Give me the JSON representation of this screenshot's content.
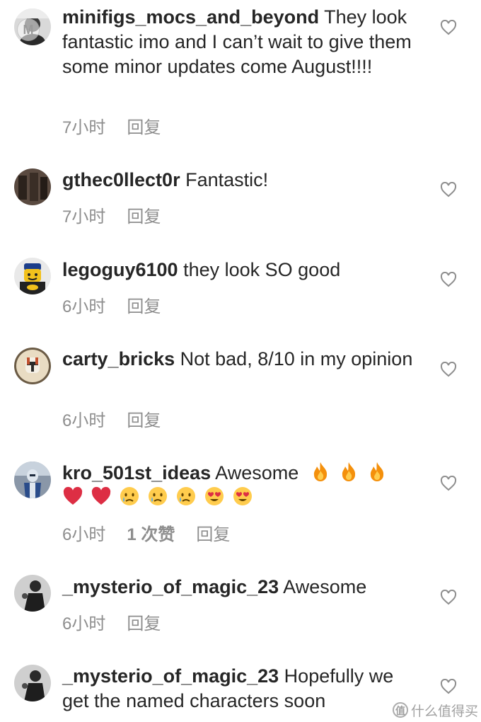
{
  "comments": [
    {
      "username": "minifigs_mocs_and_beyond",
      "text": " They look fantastic imo and I can’t wait to give them some minor updates come August!!!!",
      "time": "7小时",
      "reply": "回复",
      "avatar_icon": "avatar-person-icon"
    },
    {
      "username": "gthec0llect0r",
      "text": " Fantastic!",
      "time": "7小时",
      "reply": "回复",
      "avatar_icon": "avatar-figure-icon"
    },
    {
      "username": "legoguy6100",
      "text": " they look SO good",
      "time": "6小时",
      "reply": "回复",
      "avatar_icon": "avatar-lego-minifig-icon"
    },
    {
      "username": "carty_bricks",
      "text": " Not bad, 8/10 in my opinion",
      "time": "6小时",
      "reply": "回复",
      "avatar_icon": "avatar-clone-trooper-icon"
    },
    {
      "username": "kro_501st_ideas",
      "text": " Awesome",
      "time": "6小时",
      "likes": "1 次赞",
      "reply": "回复",
      "avatar_icon": "avatar-trooper-icon",
      "emojis_line1": [
        "fire",
        "fire",
        "fire"
      ],
      "emojis_line2": [
        "red-heart",
        "red-heart",
        "crying-face",
        "crying-face",
        "crying-face",
        "heart-eyes",
        "heart-eyes"
      ]
    },
    {
      "username": "_mysterio_of_magic_23",
      "text": " Awesome",
      "time": "6小时",
      "reply": "回复",
      "avatar_icon": "avatar-dark-figure-icon"
    },
    {
      "username": "_mysterio_of_magic_23",
      "text": " Hopefully we get the named characters soon",
      "avatar_icon": "avatar-dark-figure-icon"
    }
  ],
  "watermark": {
    "top_left": "M",
    "bottom_right": "什么值得买",
    "bottom_right_logo": "值"
  },
  "colors": {
    "text": "#262626",
    "meta": "#8e8e8e",
    "heart_outline": "#8e8e8e",
    "fire": "#f4900c",
    "red_heart": "#dd2e44",
    "emoji_face": "#ffcc4d",
    "tear": "#5dadec"
  }
}
